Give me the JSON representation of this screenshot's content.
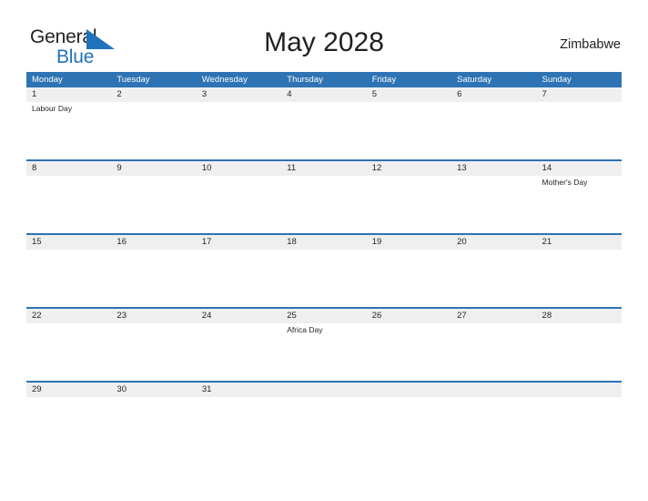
{
  "header": {
    "logo": {
      "text_top": "General",
      "text_bottom": "Blue",
      "flag_icon": "blue-triangle-flag-icon",
      "color_top": "#231f20",
      "color_bottom": "#1f72bb"
    },
    "title": "May 2028",
    "country": "Zimbabwe"
  },
  "calendar": {
    "accent_color": "#2e73b3",
    "band_color": "#efefef",
    "weekdays": [
      "Monday",
      "Tuesday",
      "Wednesday",
      "Thursday",
      "Friday",
      "Saturday",
      "Sunday"
    ],
    "weeks": [
      {
        "days": [
          {
            "num": "1",
            "event": "Labour Day"
          },
          {
            "num": "2",
            "event": ""
          },
          {
            "num": "3",
            "event": ""
          },
          {
            "num": "4",
            "event": ""
          },
          {
            "num": "5",
            "event": ""
          },
          {
            "num": "6",
            "event": ""
          },
          {
            "num": "7",
            "event": ""
          }
        ]
      },
      {
        "days": [
          {
            "num": "8",
            "event": ""
          },
          {
            "num": "9",
            "event": ""
          },
          {
            "num": "10",
            "event": ""
          },
          {
            "num": "11",
            "event": ""
          },
          {
            "num": "12",
            "event": ""
          },
          {
            "num": "13",
            "event": ""
          },
          {
            "num": "14",
            "event": "Mother's Day"
          }
        ]
      },
      {
        "days": [
          {
            "num": "15",
            "event": ""
          },
          {
            "num": "16",
            "event": ""
          },
          {
            "num": "17",
            "event": ""
          },
          {
            "num": "18",
            "event": ""
          },
          {
            "num": "19",
            "event": ""
          },
          {
            "num": "20",
            "event": ""
          },
          {
            "num": "21",
            "event": ""
          }
        ]
      },
      {
        "days": [
          {
            "num": "22",
            "event": ""
          },
          {
            "num": "23",
            "event": ""
          },
          {
            "num": "24",
            "event": ""
          },
          {
            "num": "25",
            "event": "Africa Day"
          },
          {
            "num": "26",
            "event": ""
          },
          {
            "num": "27",
            "event": ""
          },
          {
            "num": "28",
            "event": ""
          }
        ]
      },
      {
        "days": [
          {
            "num": "29",
            "event": ""
          },
          {
            "num": "30",
            "event": ""
          },
          {
            "num": "31",
            "event": ""
          },
          {
            "num": "",
            "event": ""
          },
          {
            "num": "",
            "event": ""
          },
          {
            "num": "",
            "event": ""
          },
          {
            "num": "",
            "event": ""
          }
        ]
      }
    ]
  }
}
